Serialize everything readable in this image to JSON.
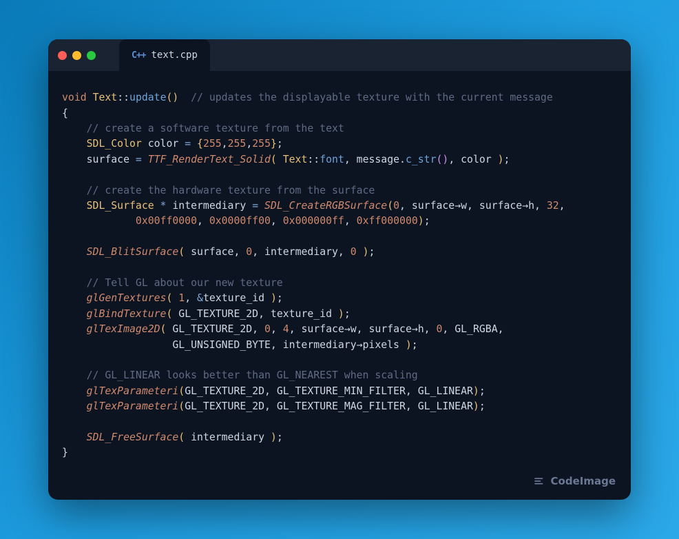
{
  "tab": {
    "icon_label": "C++",
    "filename": "text.cpp"
  },
  "footer": {
    "brand": "CodeImage"
  },
  "code": {
    "l1_void": "void",
    "l1_cls": "Text",
    "l1_scope": "::",
    "l1_fn": "update",
    "l1_par": "()",
    "l1_cmnt": "// updates the displayable texture with the current message",
    "l2": "{",
    "l3_cmnt": "// create a software texture from the text",
    "l4_type": "SDL_Color",
    "l4_var": " color ",
    "l4_eq": "=",
    "l4_brace_o": " {",
    "l4_n1": "255",
    "l4_c1": ",",
    "l4_n2": "255",
    "l4_c2": ",",
    "l4_n3": "255",
    "l4_brace_c": "}",
    "l4_semi": ";",
    "l5_lhs": "    surface ",
    "l5_eq": "=",
    "l5_fn": " TTF_RenderText_Solid",
    "l5_po": "(",
    "l5_cls": " Text",
    "l5_scope": "::",
    "l5_font": "font",
    "l5_c1": ", ",
    "l5_msg": "message",
    "l5_dot": ".",
    "l5_cstr": "c_str",
    "l5_par2": "()",
    "l5_c2": ", color ",
    "l5_pc": ")",
    "l5_semi": ";",
    "l7_cmnt": "// create the hardware texture from the surface",
    "l8_type": "SDL_Surface",
    "l8_star": " *",
    "l8_var": " intermediary ",
    "l8_eq": "=",
    "l8_fn": " SDL_CreateRGBSurface",
    "l8_po": "(",
    "l8_n0": "0",
    "l8_rest": ", surface→w, surface→h, ",
    "l8_n32": "32",
    "l8_c": ",",
    "l9_pad": "            ",
    "l9_h1": "0x00ff0000",
    "l9_c1": ", ",
    "l9_h2": "0x0000ff00",
    "l9_c2": ", ",
    "l9_h3": "0x000000ff",
    "l9_c3": ", ",
    "l9_h4": "0xff000000",
    "l9_pc": ")",
    "l9_semi": ";",
    "l11_fn": "SDL_BlitSurface",
    "l11_po": "(",
    "l11_a1": " surface, ",
    "l11_n1": "0",
    "l11_a2": ", intermediary, ",
    "l11_n2": "0",
    "l11_a3": " ",
    "l11_pc": ")",
    "l11_semi": ";",
    "l13_cmnt": "// Tell GL about our new texture",
    "l14_fn": "glGenTextures",
    "l14_po": "(",
    "l14_sp": " ",
    "l14_n": "1",
    "l14_c": ", ",
    "l14_amp": "&",
    "l14_var": "texture_id ",
    "l14_pc": ")",
    "l14_semi": ";",
    "l15_fn": "glBindTexture",
    "l15_po": "(",
    "l15_a": " GL_TEXTURE_2D, texture_id ",
    "l15_pc": ")",
    "l15_semi": ";",
    "l16_fn": "glTexImage2D",
    "l16_po": "(",
    "l16_a1": " GL_TEXTURE_2D, ",
    "l16_n0": "0",
    "l16_c1": ", ",
    "l16_n4": "4",
    "l16_a2": ", surface→w, surface→h, ",
    "l16_n0b": "0",
    "l16_a3": ", GL_RGBA,",
    "l17_pad": "                  GL_UNSIGNED_BYTE, intermediary→pixels ",
    "l17_pc": ")",
    "l17_semi": ";",
    "l19_cmnt": "// GL_LINEAR looks better than GL_NEAREST when scaling",
    "l20_fn": "glTexParameteri",
    "l20_po": "(",
    "l20_a": "GL_TEXTURE_2D, GL_TEXTURE_MIN_FILTER, GL_LINEAR",
    "l20_pc": ")",
    "l20_semi": ";",
    "l21_fn": "glTexParameteri",
    "l21_po": "(",
    "l21_a": "GL_TEXTURE_2D, GL_TEXTURE_MAG_FILTER, GL_LINEAR",
    "l21_pc": ")",
    "l21_semi": ";",
    "l23_fn": "SDL_FreeSurface",
    "l23_po": "(",
    "l23_a": " intermediary ",
    "l23_pc": ")",
    "l23_semi": ";",
    "l24": "}"
  }
}
